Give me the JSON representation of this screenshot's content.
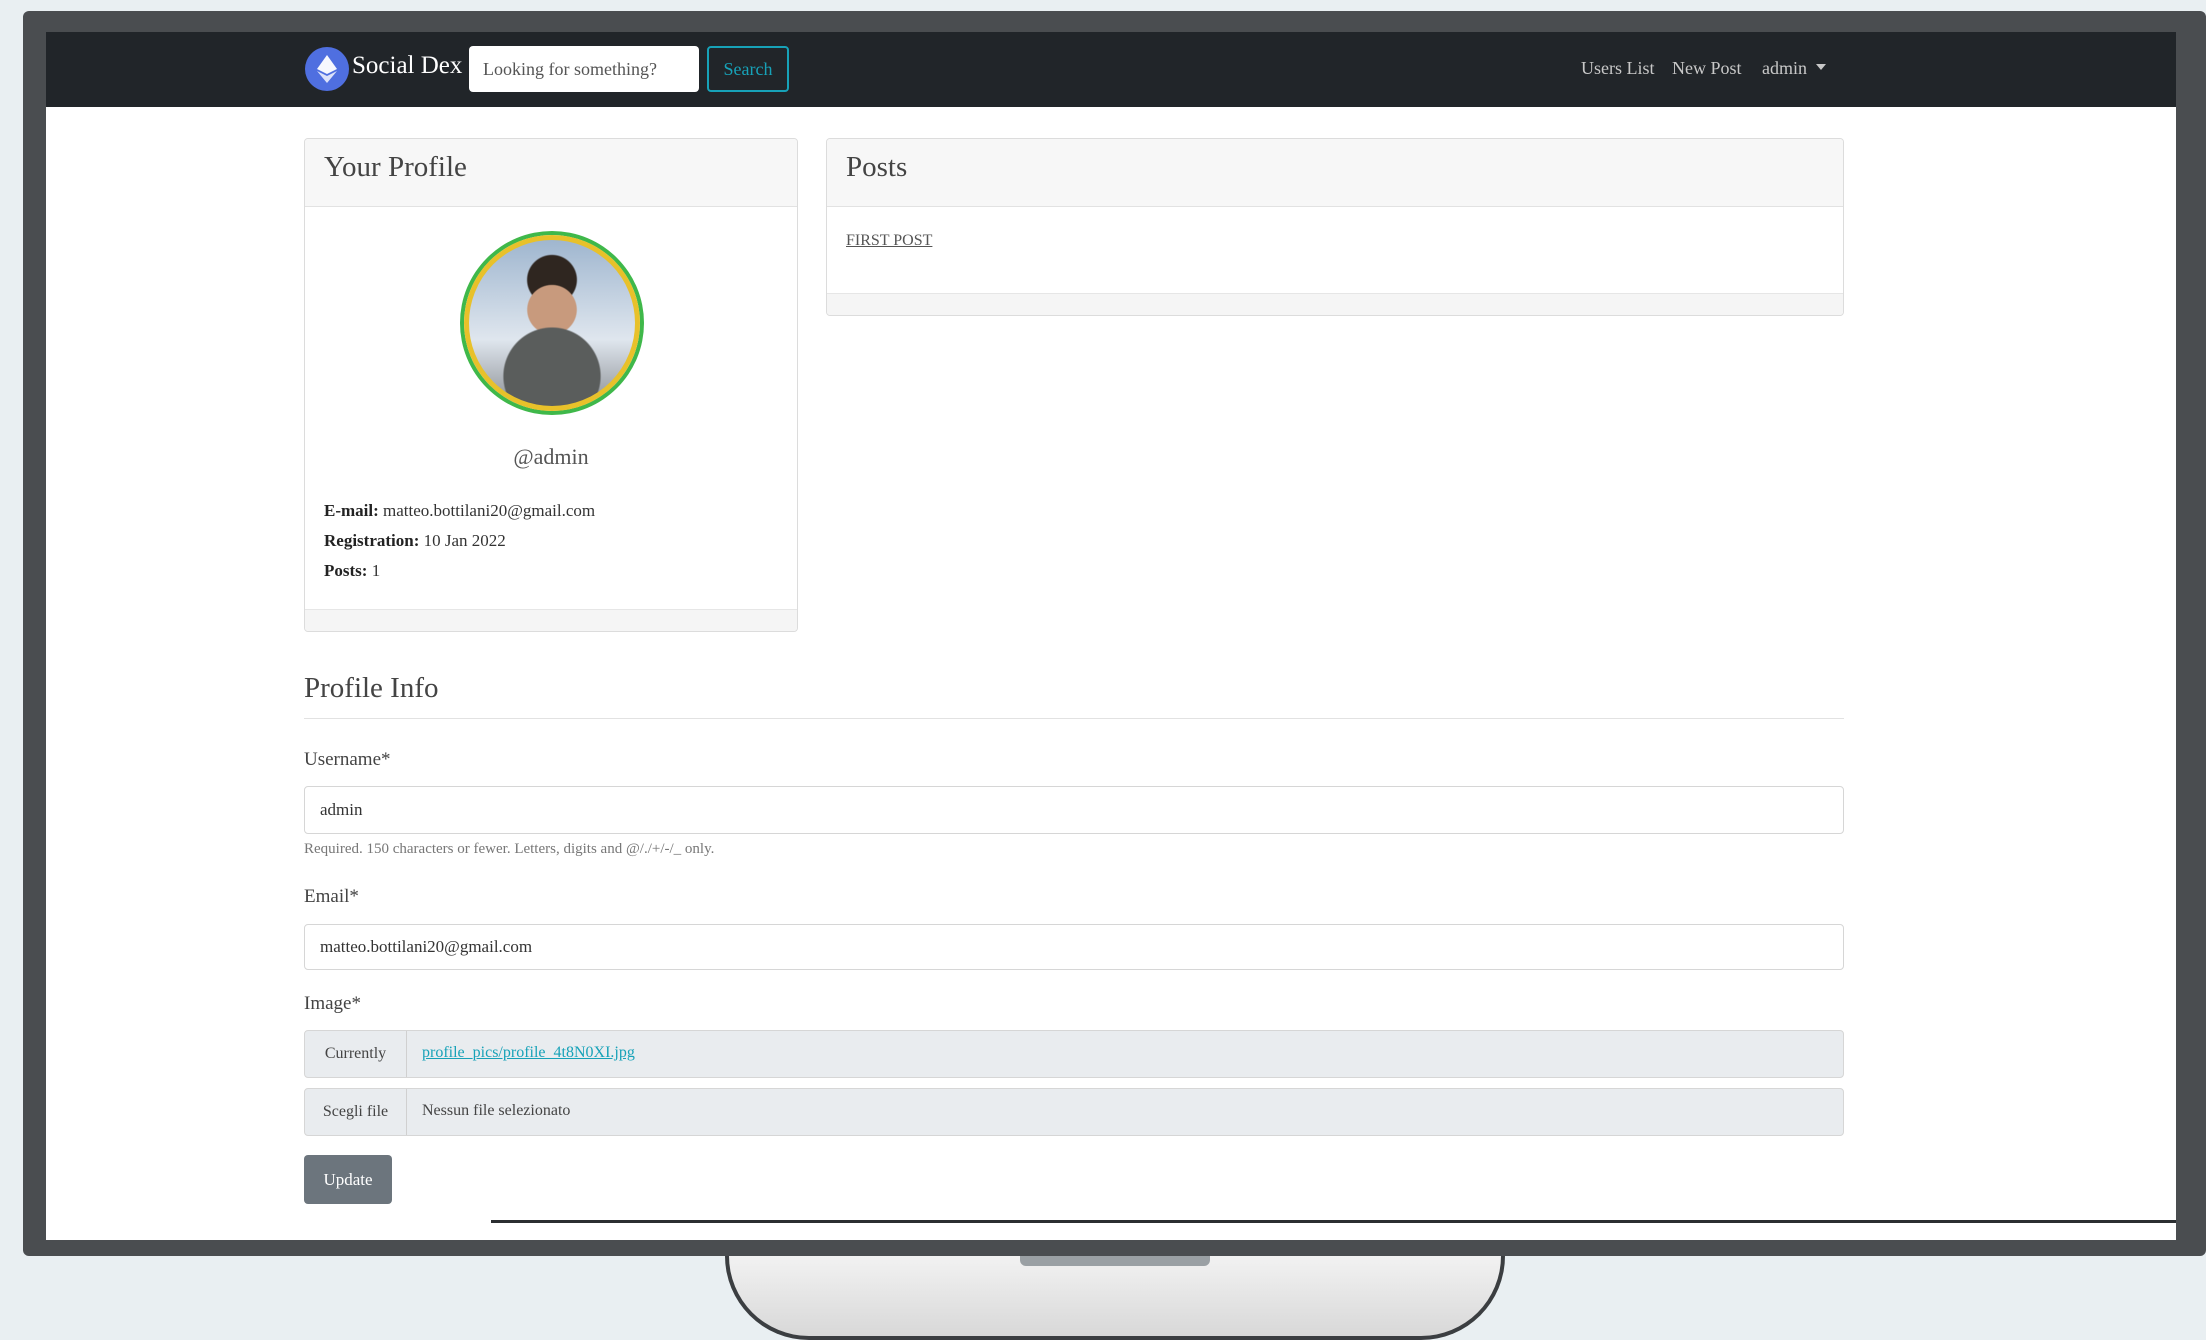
{
  "navbar": {
    "brand": "Social Dex",
    "search_placeholder": "Looking for something?",
    "search_button": "Search",
    "links": [
      "Users List",
      "New Post"
    ],
    "user_menu": "admin"
  },
  "profile_card": {
    "title": "Your Profile",
    "handle": "@admin",
    "email_label": "E-mail:",
    "email": "matteo.bottilani20@gmail.com",
    "registration_label": "Registration:",
    "registration": "10 Jan 2022",
    "posts_label": "Posts:",
    "posts": "1"
  },
  "posts_card": {
    "title": "Posts",
    "items": [
      "FIRST POST"
    ]
  },
  "form": {
    "title": "Profile Info",
    "username_label": "Username*",
    "username_value": "admin",
    "username_help": "Required. 150 characters or fewer. Letters, digits and @/./+/-/_ only.",
    "email_label": "Email*",
    "email_value": "matteo.bottilani20@gmail.com",
    "image_label": "Image*",
    "currently_label": "Currently",
    "current_file": "profile_pics/profile_4t8N0XI.jpg",
    "choose_label": "Scegli file",
    "no_file": "Nessun file selezionato",
    "update_button": "Update"
  },
  "colors": {
    "navbar": "#212529",
    "accent": "#17a2b8",
    "button": "#6c757d"
  }
}
